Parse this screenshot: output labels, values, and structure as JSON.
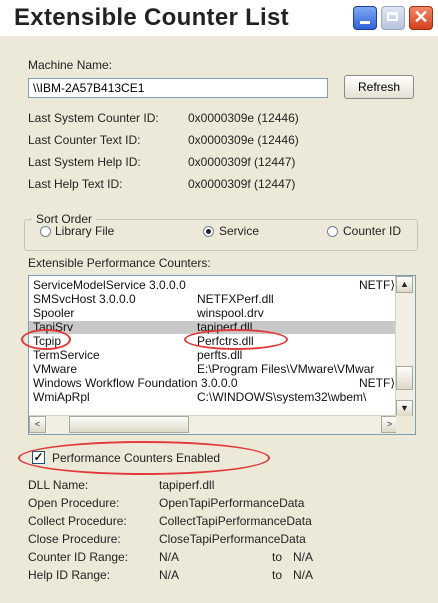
{
  "window": {
    "title": "Extensible Counter List",
    "controls": {
      "minimize": "_",
      "maximize": "□",
      "close": "✕"
    }
  },
  "machine": {
    "label": "Machine Name:",
    "value": "\\\\IBM-2A57B413CE1",
    "refresh_label": "Refresh"
  },
  "ids": [
    {
      "label": "Last System Counter ID:",
      "value": "0x0000309e  (12446)"
    },
    {
      "label": "Last Counter Text ID:",
      "value": "0x0000309e  (12446)"
    },
    {
      "label": "Last System Help ID:",
      "value": "0x0000309f  (12447)"
    },
    {
      "label": "Last Help Text ID:",
      "value": "0x0000309f  (12447)"
    }
  ],
  "sort_order": {
    "label": "Sort Order",
    "options": [
      {
        "label": "Library File",
        "selected": false
      },
      {
        "label": "Service",
        "selected": true
      },
      {
        "label": "Counter ID",
        "selected": false
      }
    ]
  },
  "counters": {
    "label": "Extensible Performance Counters:",
    "rows": [
      {
        "name": "ServiceModelService 3.0.0.0",
        "dll": "",
        "extra": "NETF⟩"
      },
      {
        "name": "SMSvcHost 3.0.0.0",
        "dll": "NETFXPerf.dll",
        "extra": ""
      },
      {
        "name": "Spooler",
        "dll": "winspool.drv",
        "extra": ""
      },
      {
        "name": "TapiSrv",
        "dll": "tapiperf.dll",
        "extra": "",
        "selected": true
      },
      {
        "name": "Tcpip",
        "dll": "Perfctrs.dll",
        "extra": ""
      },
      {
        "name": "TermService",
        "dll": "perfts.dll",
        "extra": ""
      },
      {
        "name": "VMware",
        "dll": "E:\\Program Files\\VMware\\VMwar",
        "extra": ""
      },
      {
        "name": "Windows Workflow Foundation 3.0.0.0",
        "dll": "",
        "extra": "NETF⟩"
      },
      {
        "name": "WmiApRpl",
        "dll": "C:\\WINDOWS\\system32\\wbem\\",
        "extra": ""
      }
    ],
    "scroll_up": "▲",
    "scroll_down": "▼",
    "scroll_left": "<",
    "scroll_right": ">"
  },
  "enabled": {
    "label": "Performance Counters Enabled",
    "checked": true,
    "mark": "✓"
  },
  "details": [
    {
      "label": "DLL Name:",
      "value": "tapiperf.dll"
    },
    {
      "label": "Open Procedure:",
      "value": "OpenTapiPerformanceData"
    },
    {
      "label": "Collect Procedure:",
      "value": "CollectTapiPerformanceData"
    },
    {
      "label": "Close Procedure:",
      "value": "CloseTapiPerformanceData"
    }
  ],
  "ranges": [
    {
      "label": "Counter ID Range:",
      "from": "N/A",
      "to_label": "to",
      "to": "N/A"
    },
    {
      "label": "Help ID Range:",
      "from": "N/A",
      "to_label": "to",
      "to": "N/A"
    }
  ],
  "colors": {
    "annotation": "#e23a3a",
    "selected_row": "#c8c8c8",
    "panel": "#ece9d8"
  }
}
